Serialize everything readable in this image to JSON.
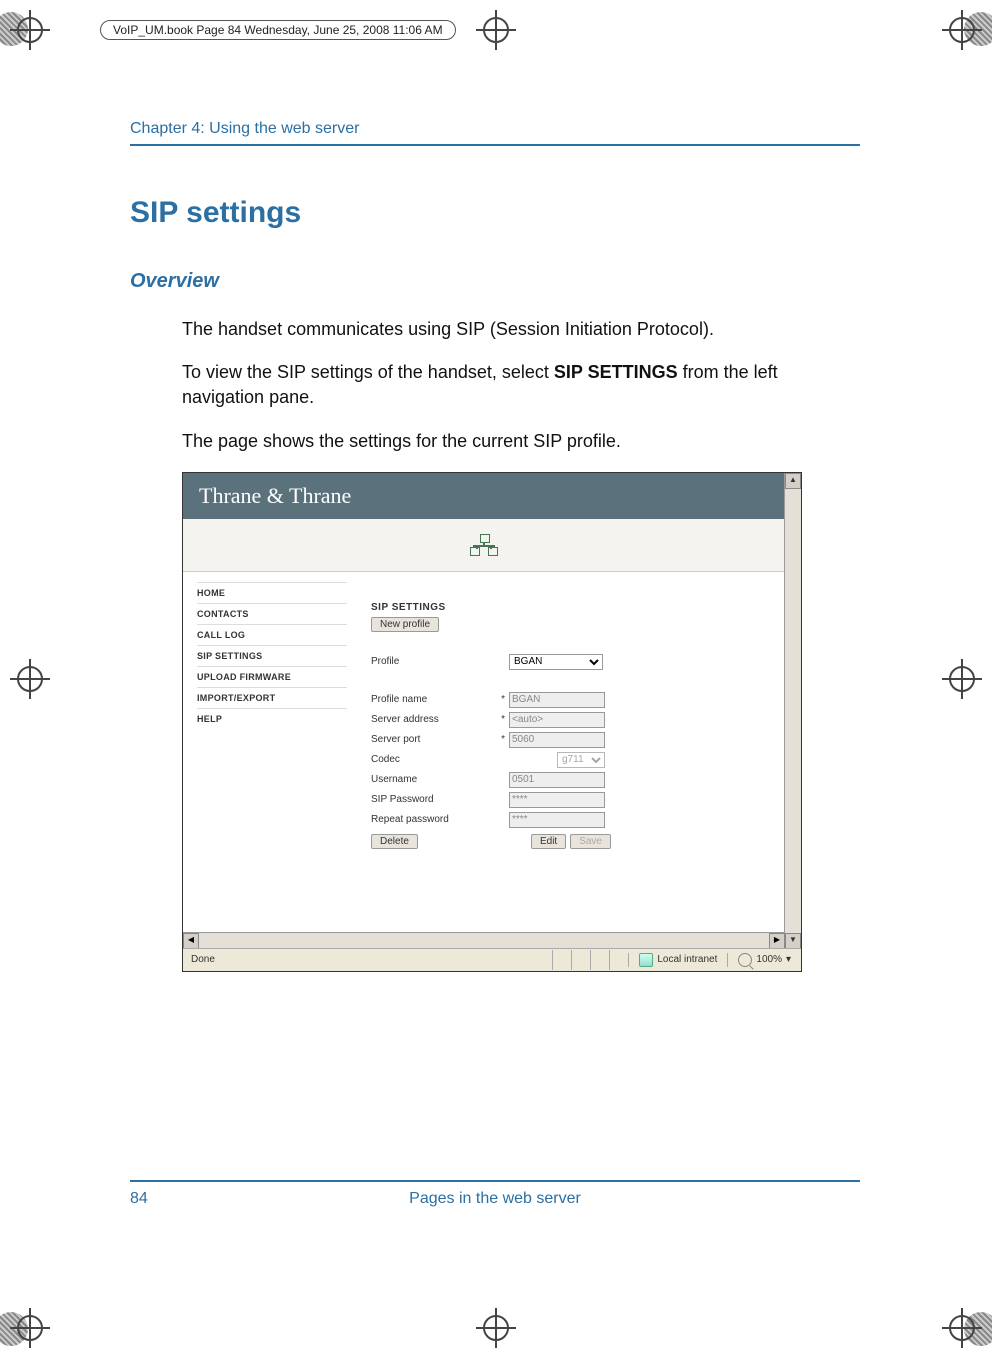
{
  "book_header": "VoIP_UM.book  Page 84  Wednesday, June 25, 2008  11:06 AM",
  "chapter": "Chapter 4:  Using the web server",
  "heading": "SIP settings",
  "subheading": "Overview",
  "para1": "The handset communicates using SIP (Session Initiation Protocol).",
  "para2_a": "To view the SIP settings of the handset, select ",
  "para2_bold": "SIP SETTINGS",
  "para2_b": " from the left navigation pane.",
  "para3": "The page shows the settings for the current SIP profile.",
  "footer": {
    "page_number": "84",
    "title": "Pages in the web server"
  },
  "screenshot": {
    "brand": "Thrane & Thrane",
    "nav": [
      "HOME",
      "CONTACTS",
      "CALL LOG",
      "SIP SETTINGS",
      "UPLOAD FIRMWARE",
      "IMPORT/EXPORT",
      "HELP"
    ],
    "section_title": "SIP SETTINGS",
    "new_profile_btn": "New profile",
    "labels": {
      "profile": "Profile",
      "profile_name": "Profile name",
      "server_address": "Server address",
      "server_port": "Server port",
      "codec": "Codec",
      "username": "Username",
      "sip_password": "SIP Password",
      "repeat_password": "Repeat password"
    },
    "values": {
      "profile_select": "BGAN",
      "profile_name": "BGAN",
      "server_address": "<auto>",
      "server_port": "5060",
      "codec": "g711",
      "username": "0501",
      "sip_password": "****",
      "repeat_password": "****"
    },
    "buttons": {
      "delete": "Delete",
      "edit": "Edit",
      "save": "Save"
    },
    "status": {
      "done": "Done",
      "zone": "Local intranet",
      "zoom": "100%",
      "zoom_arrow": "▾"
    }
  }
}
